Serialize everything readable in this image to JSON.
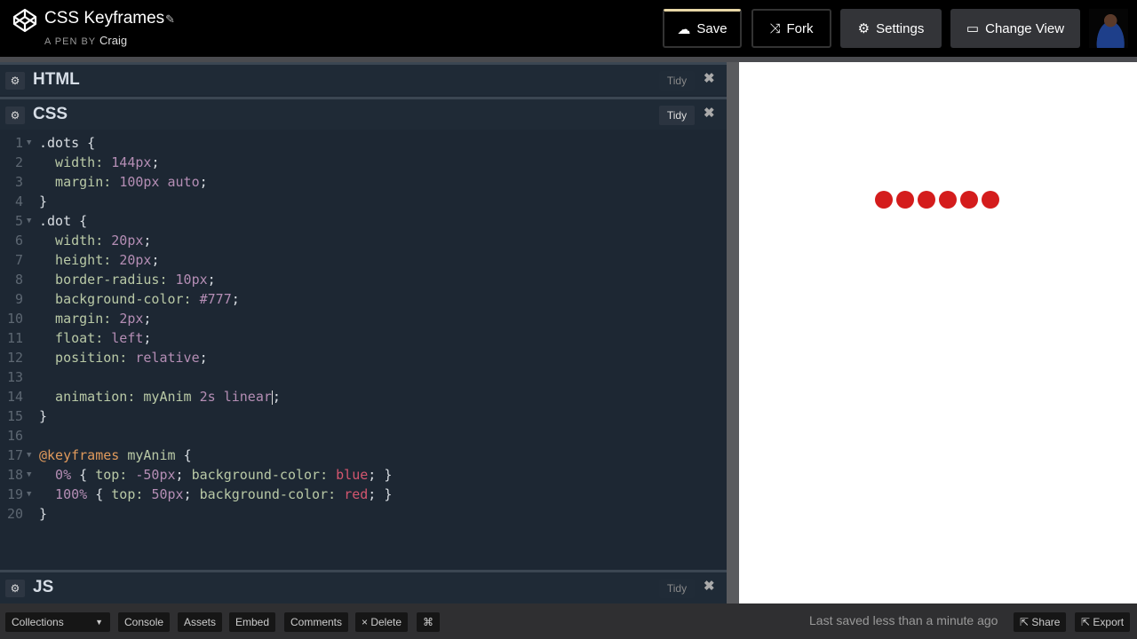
{
  "header": {
    "title": "CSS Keyframes",
    "byline_prefix": "A PEN BY",
    "author": "Craig",
    "buttons": {
      "save": "Save",
      "fork": "Fork",
      "settings": "Settings",
      "change_view": "Change View"
    }
  },
  "panels": {
    "html": {
      "label": "HTML",
      "tidy": "Tidy",
      "close": "✖"
    },
    "css": {
      "label": "CSS",
      "tidy": "Tidy",
      "close": "✖"
    },
    "js": {
      "label": "JS",
      "tidy": "Tidy",
      "close": "✖"
    }
  },
  "code": [
    {
      "n": "1",
      "fold": true,
      "tokens": [
        [
          "t",
          ".dots {"
        ]
      ]
    },
    {
      "n": "2",
      "tokens": [
        [
          "p",
          "  width: "
        ],
        [
          "n",
          "144px"
        ],
        [
          "t",
          ";"
        ]
      ]
    },
    {
      "n": "3",
      "tokens": [
        [
          "p",
          "  margin: "
        ],
        [
          "n",
          "100px auto"
        ],
        [
          "t",
          ";"
        ]
      ]
    },
    {
      "n": "4",
      "tokens": [
        [
          "t",
          "}"
        ]
      ]
    },
    {
      "n": "5",
      "fold": true,
      "tokens": [
        [
          "t",
          ".dot {"
        ]
      ]
    },
    {
      "n": "6",
      "tokens": [
        [
          "p",
          "  width: "
        ],
        [
          "n",
          "20px"
        ],
        [
          "t",
          ";"
        ]
      ]
    },
    {
      "n": "7",
      "tokens": [
        [
          "p",
          "  height: "
        ],
        [
          "n",
          "20px"
        ],
        [
          "t",
          ";"
        ]
      ]
    },
    {
      "n": "8",
      "tokens": [
        [
          "p",
          "  border-radius: "
        ],
        [
          "n",
          "10px"
        ],
        [
          "t",
          ";"
        ]
      ]
    },
    {
      "n": "9",
      "tokens": [
        [
          "p",
          "  background-color: "
        ],
        [
          "n",
          "#777"
        ],
        [
          "t",
          ";"
        ]
      ]
    },
    {
      "n": "10",
      "tokens": [
        [
          "p",
          "  margin: "
        ],
        [
          "n",
          "2px"
        ],
        [
          "t",
          ";"
        ]
      ]
    },
    {
      "n": "11",
      "tokens": [
        [
          "p",
          "  float: "
        ],
        [
          "n",
          "left"
        ],
        [
          "t",
          ";"
        ]
      ]
    },
    {
      "n": "12",
      "tokens": [
        [
          "p",
          "  position: "
        ],
        [
          "n",
          "relative"
        ],
        [
          "t",
          ";"
        ]
      ]
    },
    {
      "n": "13",
      "tokens": []
    },
    {
      "n": "14",
      "cursor": true,
      "tokens": [
        [
          "p",
          "  animation: "
        ],
        [
          "p",
          "myAnim "
        ],
        [
          "n",
          "2s linear"
        ],
        [
          "t",
          ";"
        ]
      ]
    },
    {
      "n": "15",
      "tokens": [
        [
          "t",
          "}"
        ]
      ]
    },
    {
      "n": "16",
      "tokens": []
    },
    {
      "n": "17",
      "fold": true,
      "tokens": [
        [
          "k",
          "@keyframes"
        ],
        [
          "p",
          " myAnim "
        ],
        [
          "t",
          "{"
        ]
      ]
    },
    {
      "n": "18",
      "fold": true,
      "tokens": [
        [
          "n",
          "  0%"
        ],
        [
          "t",
          " { "
        ],
        [
          "p",
          "top: "
        ],
        [
          "n",
          "-50px"
        ],
        [
          "t",
          "; "
        ],
        [
          "p",
          "background-color: "
        ],
        [
          "c",
          "blue"
        ],
        [
          "t",
          "; }"
        ]
      ]
    },
    {
      "n": "19",
      "fold": true,
      "tokens": [
        [
          "n",
          "  100%"
        ],
        [
          "t",
          " { "
        ],
        [
          "p",
          "top: "
        ],
        [
          "n",
          "50px"
        ],
        [
          "t",
          "; "
        ],
        [
          "p",
          "background-color: "
        ],
        [
          "c",
          "red"
        ],
        [
          "t",
          "; }"
        ]
      ]
    },
    {
      "n": "20",
      "tokens": [
        [
          "t",
          "}"
        ]
      ]
    }
  ],
  "preview": {
    "dot_count": 6,
    "dot_color": "#d41c1c"
  },
  "footer": {
    "collections": "Collections",
    "console": "Console",
    "assets": "Assets",
    "embed": "Embed",
    "comments": "Comments",
    "delete": "× Delete",
    "shortcuts": "⌘",
    "status": "Last saved less than a minute ago",
    "share": "Share",
    "export": "Export"
  }
}
